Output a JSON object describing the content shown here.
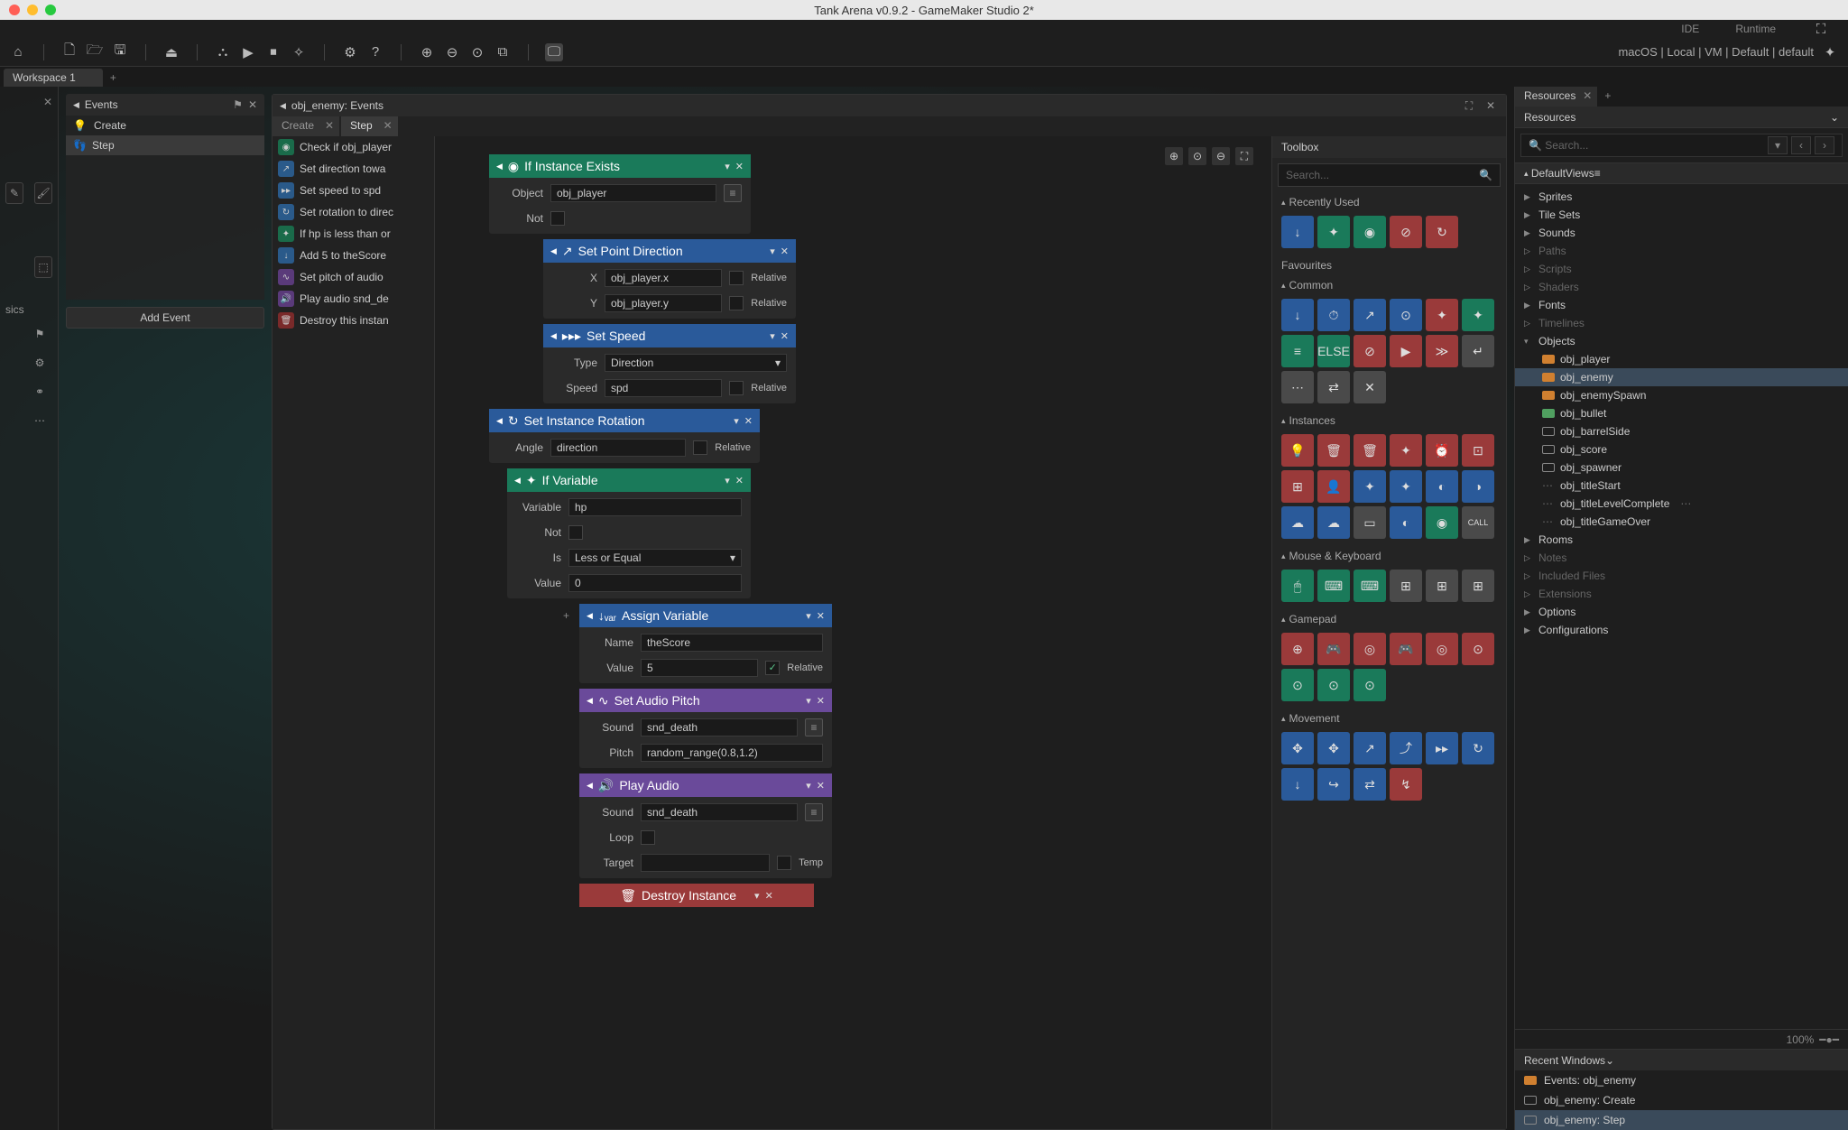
{
  "titlebar": {
    "title": "Tank Arena v0.9.2 - GameMaker Studio 2*"
  },
  "topbar": {
    "ide": "IDE",
    "runtime": "Runtime"
  },
  "toolbar_right": {
    "target": "macOS | Local | VM | Default | default"
  },
  "workspace_tab": "Workspace 1",
  "left_side_label": "sics",
  "events_panel": {
    "title": "Events",
    "items": [
      "Create",
      "Step"
    ],
    "add": "Add Event"
  },
  "editor": {
    "title": "obj_enemy: Events",
    "tabs": [
      "Create",
      "Step"
    ],
    "active_tab": 1
  },
  "action_list": [
    {
      "icon": "green",
      "label": "Check if obj_player"
    },
    {
      "icon": "blue",
      "label": "Set direction towa"
    },
    {
      "icon": "blue",
      "label": "Set speed to spd"
    },
    {
      "icon": "blue",
      "label": "Set rotation to direc"
    },
    {
      "icon": "green",
      "label": "If hp is less than or"
    },
    {
      "icon": "blue",
      "label": "Add 5 to theScore"
    },
    {
      "icon": "purple",
      "label": "Set pitch of audio"
    },
    {
      "icon": "purple",
      "label": "Play audio snd_de"
    },
    {
      "icon": "red",
      "label": "Destroy this instan"
    }
  ],
  "nodes": {
    "ifInstance": {
      "title": "If Instance Exists",
      "object_lbl": "Object",
      "object": "obj_player",
      "not_lbl": "Not"
    },
    "setPoint": {
      "title": "Set Point Direction",
      "x_lbl": "X",
      "x": "obj_player.x",
      "y_lbl": "Y",
      "y": "obj_player.y",
      "rel": "Relative"
    },
    "setSpeed": {
      "title": "Set Speed",
      "type_lbl": "Type",
      "type": "Direction",
      "speed_lbl": "Speed",
      "speed": "spd",
      "rel": "Relative"
    },
    "setRot": {
      "title": "Set Instance Rotation",
      "angle_lbl": "Angle",
      "angle": "direction",
      "rel": "Relative"
    },
    "ifVar": {
      "title": "If Variable",
      "var_lbl": "Variable",
      "var": "hp",
      "not_lbl": "Not",
      "is_lbl": "Is",
      "is": "Less or Equal",
      "val_lbl": "Value",
      "val": "0"
    },
    "assign": {
      "title": "Assign Variable",
      "name_lbl": "Name",
      "name": "theScore",
      "val_lbl": "Value",
      "val": "5",
      "rel": "Relative"
    },
    "pitch": {
      "title": "Set Audio Pitch",
      "sound_lbl": "Sound",
      "sound": "snd_death",
      "pitch_lbl": "Pitch",
      "pitch": "random_range(0.8,1.2)"
    },
    "play": {
      "title": "Play Audio",
      "sound_lbl": "Sound",
      "sound": "snd_death",
      "loop_lbl": "Loop",
      "target_lbl": "Target",
      "temp": "Temp"
    },
    "destroy": {
      "title": "Destroy Instance"
    }
  },
  "toolbox": {
    "title": "Toolbox",
    "search": "Search...",
    "sections": [
      "Recently Used",
      "Favourites",
      "Common",
      "Instances",
      "Mouse & Keyboard",
      "Gamepad",
      "Movement"
    ]
  },
  "resources": {
    "tab": "Resources",
    "header": "Resources",
    "search": "Search...",
    "default": "Default",
    "views": "Views",
    "folders": [
      "Sprites",
      "Tile Sets",
      "Sounds",
      "Paths",
      "Scripts",
      "Shaders",
      "Fonts",
      "Timelines",
      "Objects",
      "Rooms",
      "Notes",
      "Included Files",
      "Extensions",
      "Options",
      "Configurations"
    ],
    "objects": [
      {
        "name": "obj_player",
        "ico": "or"
      },
      {
        "name": "obj_enemy",
        "ico": "or",
        "sel": true
      },
      {
        "name": "obj_enemySpawn",
        "ico": "or"
      },
      {
        "name": "obj_bullet",
        "ico": "gr"
      },
      {
        "name": "obj_barrelSide",
        "ico": "wh"
      },
      {
        "name": "obj_score",
        "ico": "wh"
      },
      {
        "name": "obj_spawner",
        "ico": "wh"
      },
      {
        "name": "obj_titleStart",
        "ico": ""
      },
      {
        "name": "obj_titleLevelComplete",
        "ico": ""
      },
      {
        "name": "obj_titleGameOver",
        "ico": ""
      }
    ],
    "zoom": "100%"
  },
  "recent": {
    "title": "Recent Windows",
    "items": [
      {
        "label": "Events: obj_enemy",
        "ico": "or"
      },
      {
        "label": "obj_enemy: Create",
        "ico": "wh"
      },
      {
        "label": "obj_enemy: Step",
        "ico": "wh",
        "sel": true
      }
    ]
  }
}
